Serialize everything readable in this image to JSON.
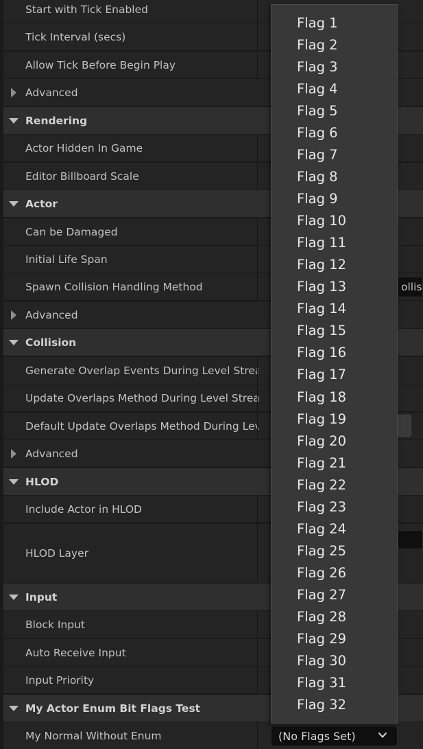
{
  "rows": [
    {
      "label": "Start with Tick Enabled",
      "kind": "prop"
    },
    {
      "label": "Tick Interval (secs)",
      "kind": "prop"
    },
    {
      "label": "Allow Tick Before Begin Play",
      "kind": "prop"
    },
    {
      "label": "Advanced",
      "kind": "advanced"
    },
    {
      "label": "Rendering",
      "kind": "category"
    },
    {
      "label": "Actor Hidden In Game",
      "kind": "prop"
    },
    {
      "label": "Editor Billboard Scale",
      "kind": "prop"
    },
    {
      "label": "Actor",
      "kind": "category"
    },
    {
      "label": "Can be Damaged",
      "kind": "prop"
    },
    {
      "label": "Initial Life Span",
      "kind": "prop"
    },
    {
      "label": "Spawn Collision Handling Method",
      "kind": "prop"
    },
    {
      "label": "Advanced",
      "kind": "advanced"
    },
    {
      "label": "Collision",
      "kind": "category"
    },
    {
      "label": "Generate Overlap Events During Level Streami…",
      "kind": "prop"
    },
    {
      "label": "Update Overlaps Method During Level Stream…",
      "kind": "prop"
    },
    {
      "label": "Default Update Overlaps Method During Level…",
      "kind": "prop"
    },
    {
      "label": "Advanced",
      "kind": "advanced"
    },
    {
      "label": "HLOD",
      "kind": "category"
    },
    {
      "label": "Include Actor in HLOD",
      "kind": "prop"
    },
    {
      "label": "HLOD Layer",
      "kind": "prop"
    },
    {
      "label": "Input",
      "kind": "category"
    },
    {
      "label": "Block Input",
      "kind": "prop"
    },
    {
      "label": "Auto Receive Input",
      "kind": "prop"
    },
    {
      "label": "Input Priority",
      "kind": "prop"
    },
    {
      "label": "My Actor Enum Bit Flags Test",
      "kind": "category"
    },
    {
      "label": "My Normal Without Enum",
      "kind": "prop"
    }
  ],
  "spawn_value_peek": "ollisio",
  "dropdown": {
    "flags": [
      "Flag 1",
      "Flag 2",
      "Flag 3",
      "Flag 4",
      "Flag 5",
      "Flag 6",
      "Flag 7",
      "Flag 8",
      "Flag 9",
      "Flag 10",
      "Flag 11",
      "Flag 12",
      "Flag 13",
      "Flag 14",
      "Flag 15",
      "Flag 16",
      "Flag 17",
      "Flag 18",
      "Flag 19",
      "Flag 20",
      "Flag 21",
      "Flag 22",
      "Flag 23",
      "Flag 24",
      "Flag 25",
      "Flag 26",
      "Flag 27",
      "Flag 28",
      "Flag 29",
      "Flag 30",
      "Flag 31",
      "Flag 32"
    ]
  },
  "combo": {
    "value": "(No Flags Set)",
    "icon": "chevron-down-icon"
  },
  "colors": {
    "row_bg": "#242424",
    "category_bg": "#2f2f2f",
    "dropdown_bg": "#383838",
    "text": "#c2c2c2"
  }
}
